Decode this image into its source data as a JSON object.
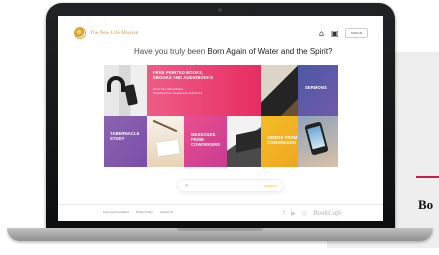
{
  "site": {
    "logo_text": "The New Life Mission",
    "headline_prefix": "Have you truly been",
    "headline_emphasis": "Born Again of Water and the Spirit?",
    "sign_in": "SIGN IN"
  },
  "tiles": {
    "books_title": "FREE PRINTED BOOKS, eBOOKS AND AUDIOBOOKS",
    "books_sub_1": "Read Your Gifted Books",
    "books_sub_2": "Download Free ebooks and audiobooks",
    "sermons": "SERMONS",
    "tabernacle": "TABERNACLE STUDY",
    "messages": "MESSAGES FROM COWORKERS",
    "videos": "VIDEOS FROM COWORKERS"
  },
  "search": {
    "placeholder": "",
    "button_label": "SEARCH"
  },
  "footer": {
    "links": [
      "Terms and Conditions",
      "Privacy Policy",
      "Contact Us"
    ],
    "brand": "BookCafe"
  },
  "side": {
    "partial_text": "Bo"
  },
  "colors": {
    "pink": "#e72d62",
    "purple": "#7a4ea9",
    "blue_purple": "#4d59a7",
    "yellow": "#efa621",
    "accent_rule": "#c81d4f"
  },
  "icons": {
    "logo": "circular-mission-logo",
    "user": "user-icon",
    "cart": "cart-icon",
    "search": "search-icon",
    "facebook": "facebook-icon",
    "youtube": "youtube-icon",
    "instagram": "instagram-icon"
  }
}
